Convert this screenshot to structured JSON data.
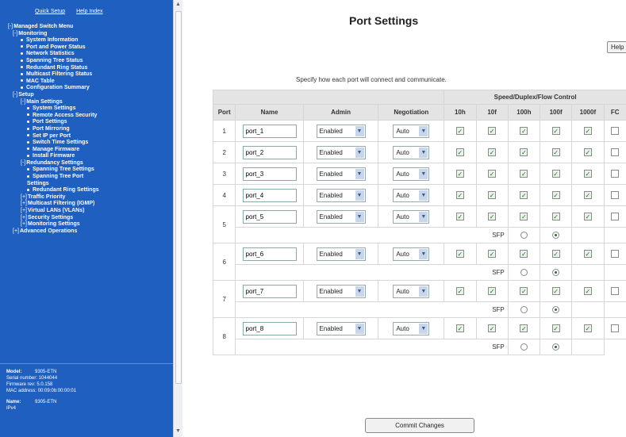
{
  "sidebar": {
    "quick_setup": "Quick Setup",
    "help_index": "Help Index",
    "tree": [
      {
        "prefix": "[-]",
        "label": "Managed Switch Menu",
        "level": 0
      },
      {
        "prefix": "[-]",
        "label": "Monitoring",
        "level": 1
      },
      {
        "prefix": "•",
        "label": "System Information",
        "level": 2
      },
      {
        "prefix": "•",
        "label": "Port and Power Status",
        "level": 2
      },
      {
        "prefix": "•",
        "label": "Network Statistics",
        "level": 2
      },
      {
        "prefix": "•",
        "label": "Spanning Tree Status",
        "level": 2
      },
      {
        "prefix": "•",
        "label": "Redundant Ring Status",
        "level": 2
      },
      {
        "prefix": "•",
        "label": "Multicast Filtering Status",
        "level": 2
      },
      {
        "prefix": "•",
        "label": "MAC Table",
        "level": 2
      },
      {
        "prefix": "•",
        "label": "Configuration Summary",
        "level": 2
      },
      {
        "prefix": "[-]",
        "label": "Setup",
        "level": 1
      },
      {
        "prefix": "[-]",
        "label": "Main Settings",
        "level": 2
      },
      {
        "prefix": "•",
        "label": "System Settings",
        "level": 3
      },
      {
        "prefix": "•",
        "label": "Remote Access Security",
        "level": 3
      },
      {
        "prefix": "•",
        "label": "Port Settings",
        "level": 3
      },
      {
        "prefix": "•",
        "label": "Port Mirroring",
        "level": 3
      },
      {
        "prefix": "•",
        "label": "Set IP per Port",
        "level": 3
      },
      {
        "prefix": "•",
        "label": "Switch Time Settings",
        "level": 3
      },
      {
        "prefix": "•",
        "label": "Manage Firmware",
        "level": 3
      },
      {
        "prefix": "•",
        "label": "Install Firmware",
        "level": 3
      },
      {
        "prefix": "[-]",
        "label": "Redundancy Settings",
        "level": 2
      },
      {
        "prefix": "•",
        "label": "Spanning Tree Settings",
        "level": 3
      },
      {
        "prefix": "•",
        "label": "Spanning Tree Port",
        "level": 3
      },
      {
        "prefix": "",
        "label": "Settings",
        "level": 3
      },
      {
        "prefix": "•",
        "label": "Redundant Ring Settings",
        "level": 3
      },
      {
        "prefix": "[+]",
        "label": "Traffic Priority",
        "level": 2
      },
      {
        "prefix": "[+]",
        "label": "Multicast Filtering (IGMP)",
        "level": 2
      },
      {
        "prefix": "[+]",
        "label": "Virtual LANs (VLANs)",
        "level": 2
      },
      {
        "prefix": "[+]",
        "label": "Security Settings",
        "level": 2
      },
      {
        "prefix": "[+]",
        "label": "Monitoring Settings",
        "level": 2
      },
      {
        "prefix": "[+]",
        "label": "Advanced Operations",
        "level": 1
      }
    ],
    "sysinfo": {
      "model_label": "Model:",
      "model": "9305-ETN",
      "serial_label": "Serial number:",
      "serial": "1044044",
      "firmware_label": "Firmware rev:",
      "firmware": "5.0.158",
      "mac_label": "MAC address:",
      "mac": "00:09:0b:00:00:01",
      "name_label": "Name:",
      "name": "9305-ETN",
      "ipv4_label": "IPv4"
    }
  },
  "main": {
    "title": "Port Settings",
    "help_label": "Help",
    "description": "Specify how each port will connect and communicate.",
    "group_header": "Speed/Duplex/Flow Control",
    "columns": [
      "Port",
      "Name",
      "Admin",
      "Negotiation",
      "10h",
      "10f",
      "100h",
      "100f",
      "1000f",
      "FC"
    ],
    "sfp_label": "SFP",
    "commit_label": "Commit Changes"
  },
  "ports": [
    {
      "port": "1",
      "name": "port_1",
      "admin": "Enabled",
      "negotiation": "Auto",
      "speeds": [
        true,
        true,
        true,
        true,
        true
      ],
      "fc": false,
      "sfp": false
    },
    {
      "port": "2",
      "name": "port_2",
      "admin": "Enabled",
      "negotiation": "Auto",
      "speeds": [
        true,
        true,
        true,
        true,
        true
      ],
      "fc": false,
      "sfp": false
    },
    {
      "port": "3",
      "name": "port_3",
      "admin": "Enabled",
      "negotiation": "Auto",
      "speeds": [
        true,
        true,
        true,
        true,
        true
      ],
      "fc": false,
      "sfp": false
    },
    {
      "port": "4",
      "name": "port_4",
      "admin": "Enabled",
      "negotiation": "Auto",
      "speeds": [
        true,
        true,
        true,
        true,
        true
      ],
      "fc": false,
      "sfp": false
    },
    {
      "port": "5",
      "name": "port_5",
      "admin": "Enabled",
      "negotiation": "Auto",
      "speeds": [
        true,
        true,
        true,
        true,
        true
      ],
      "fc": false,
      "sfp": true,
      "sfp_selected": "1000f"
    },
    {
      "port": "6",
      "name": "port_6",
      "admin": "Enabled",
      "negotiation": "Auto",
      "speeds": [
        true,
        true,
        true,
        true,
        true
      ],
      "fc": false,
      "sfp": true,
      "sfp_selected": "1000f"
    },
    {
      "port": "7",
      "name": "port_7",
      "admin": "Enabled",
      "negotiation": "Auto",
      "speeds": [
        true,
        true,
        true,
        true,
        true
      ],
      "fc": false,
      "sfp": true,
      "sfp_selected": "1000f"
    },
    {
      "port": "8",
      "name": "port_8",
      "admin": "Enabled",
      "negotiation": "Auto",
      "speeds": [
        true,
        true,
        true,
        true,
        true
      ],
      "fc": false,
      "sfp": true,
      "sfp_selected": "1000f"
    }
  ]
}
